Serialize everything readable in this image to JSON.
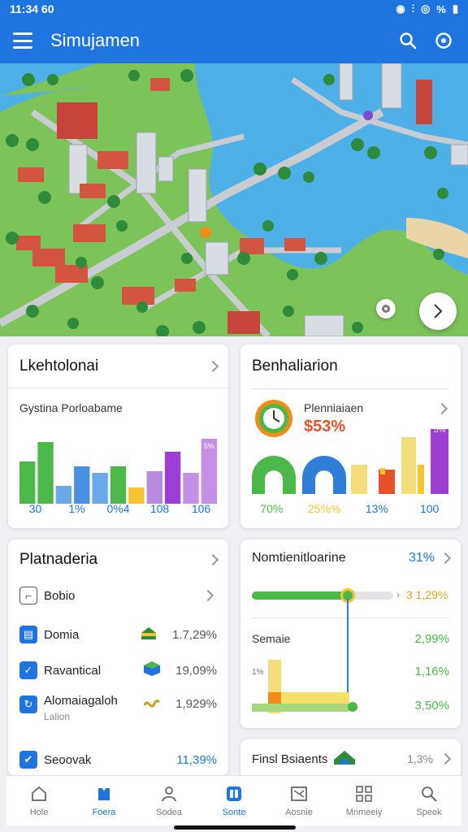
{
  "status": {
    "time": "11:34 60",
    "battery": "%"
  },
  "app": {
    "title": "Simujamen"
  },
  "cards": {
    "left_top": {
      "title": "Lkehtolonai",
      "subtitle": "Gystina Porloabame",
      "axis": [
        "30",
        "1%",
        "0%4",
        "108",
        "106"
      ],
      "bars": [
        {
          "value": 0.52,
          "color": "#4cb84a"
        },
        {
          "value": 0.76,
          "color": "#4cb84a"
        },
        {
          "value": 0.22,
          "color": "#6aa8ea"
        },
        {
          "value": 0.46,
          "color": "#4a90e2"
        },
        {
          "value": 0.38,
          "color": "#6aa8ea"
        },
        {
          "value": 0.46,
          "color": "#4cb84a"
        },
        {
          "value": 0.2,
          "color": "#f5c430"
        },
        {
          "value": 0.4,
          "color": "#b88ae0"
        },
        {
          "value": 0.64,
          "color": "#9b3ed1"
        },
        {
          "value": 0.38,
          "color": "#c490e6"
        },
        {
          "value": 0.8,
          "color": "#c490e6"
        }
      ],
      "tag": "5%"
    },
    "right_top": {
      "title": "Benhaliarion",
      "stat_label": "Plenniaiaen",
      "stat_value": "$53%",
      "axis": [
        "70%",
        "25%%",
        "13%",
        "100"
      ],
      "tag": "5%"
    },
    "left_mid": {
      "title": "Platnaderia",
      "rows": [
        {
          "label": "Bobio",
          "value": ""
        },
        {
          "label": "Domia",
          "value": "1.7,29%"
        },
        {
          "label": "Ravantical",
          "value": "19,09%"
        },
        {
          "label": "Alomaiagaloh",
          "sub": "Lalion",
          "value": "1,929%"
        },
        {
          "label": "Seoovak",
          "value": "11,39%"
        }
      ]
    },
    "right_mid": {
      "title": "Nomtienitloarine",
      "title_value": "31%",
      "progress": 0.68,
      "progress_value": "3 1,29%",
      "section": "Semaie",
      "values": [
        "2,99%",
        "1,16%",
        "3,50%"
      ],
      "small": "1%"
    },
    "right_bottom": {
      "title": "Finsl Bsiaents",
      "value": "1,3%"
    }
  },
  "nav": [
    {
      "label": "Hole",
      "icon": "home-icon"
    },
    {
      "label": "Foera",
      "icon": "bookmark-icon",
      "active": true
    },
    {
      "label": "Sodea",
      "icon": "person-icon"
    },
    {
      "label": "Sonte",
      "icon": "grid-icon",
      "active": true
    },
    {
      "label": "Aosnie",
      "icon": "image-icon"
    },
    {
      "label": "Mnmeeiy",
      "icon": "apps-icon"
    },
    {
      "label": "Speok",
      "icon": "search-icon"
    }
  ],
  "colors": {
    "primary": "#1f74e0",
    "green": "#4cb84a",
    "orange": "#e5512a",
    "purple": "#9b3ed1"
  }
}
